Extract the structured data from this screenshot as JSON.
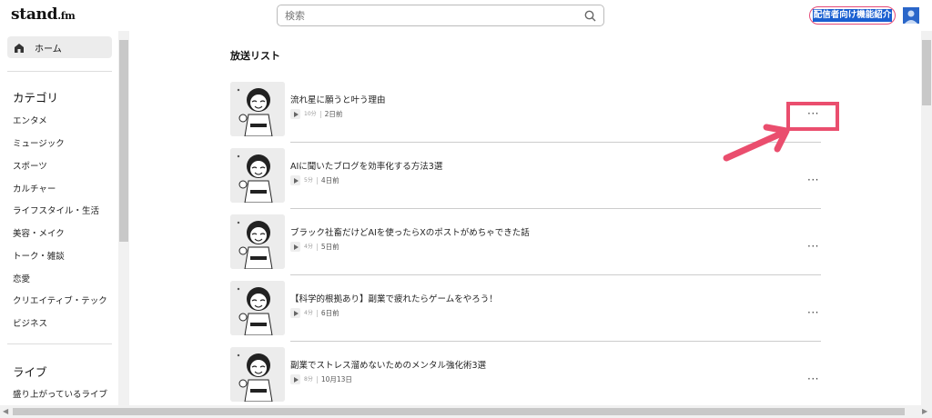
{
  "header": {
    "logo_main": "stand",
    "logo_suffix": ".fm",
    "search_placeholder": "検索",
    "creator_button": "配信者向け機能紹介"
  },
  "sidebar": {
    "home": "ホーム",
    "category_title": "カテゴリ",
    "categories": [
      "エンタメ",
      "ミュージック",
      "スポーツ",
      "カルチャー",
      "ライフスタイル・生活",
      "美容・メイク",
      "トーク・雑談",
      "恋愛",
      "クリエイティブ・テック",
      "ビジネス"
    ],
    "live_title": "ライブ",
    "live_items": [
      "盛り上がっているライブ"
    ]
  },
  "main": {
    "list_title": "放送リスト",
    "episodes": [
      {
        "title": "流れ星に願うと叶う理由",
        "duration": "10分",
        "date": "2日前"
      },
      {
        "title": "AIに聞いたブログを効率化する方法3選",
        "duration": "5分",
        "date": "4日前"
      },
      {
        "title": "ブラック社畜だけどAIを使ったらXのポストがめちゃできた話",
        "duration": "4分",
        "date": "5日前"
      },
      {
        "title": "【科学的根拠あり】副業で疲れたらゲームをやろう！",
        "duration": "4分",
        "date": "6日前"
      },
      {
        "title": "副業でストレス溜めないためのメンタル強化術3選",
        "duration": "8分",
        "date": "10月13日"
      }
    ],
    "more_label": "···"
  },
  "colors": {
    "accent_pink": "#e54977",
    "highlight": "#ea4e6e",
    "selection_blue": "#1a5fd1"
  }
}
